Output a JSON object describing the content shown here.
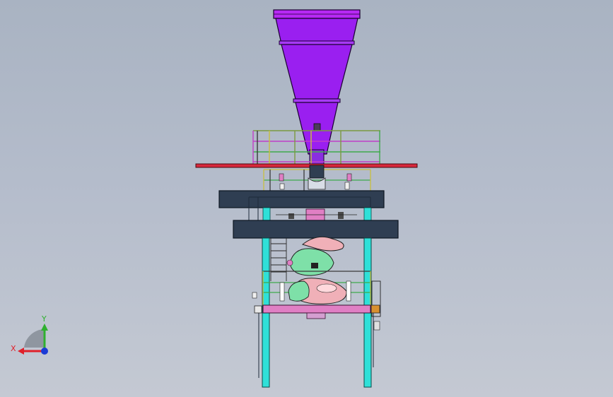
{
  "triad": {
    "x_label": "X",
    "y_label": "Y",
    "x_color": "#e0202a",
    "y_color": "#2fb02f",
    "z_color": "#1c3bd6"
  },
  "colors": {
    "hopper": "#9a1ff0",
    "hopper_edge": "#3c0a6a",
    "platform_red": "#d8283c",
    "deck": "#2f3e52",
    "column": "#2fe0d8",
    "base_beam": "#e07fc4",
    "conveyor_green": "#7ee0a8",
    "conveyor_pink": "#f0b0b8",
    "rail_yellow": "#c8c040",
    "rail_green": "#3faa4c",
    "rail_magenta": "#c040c8"
  }
}
